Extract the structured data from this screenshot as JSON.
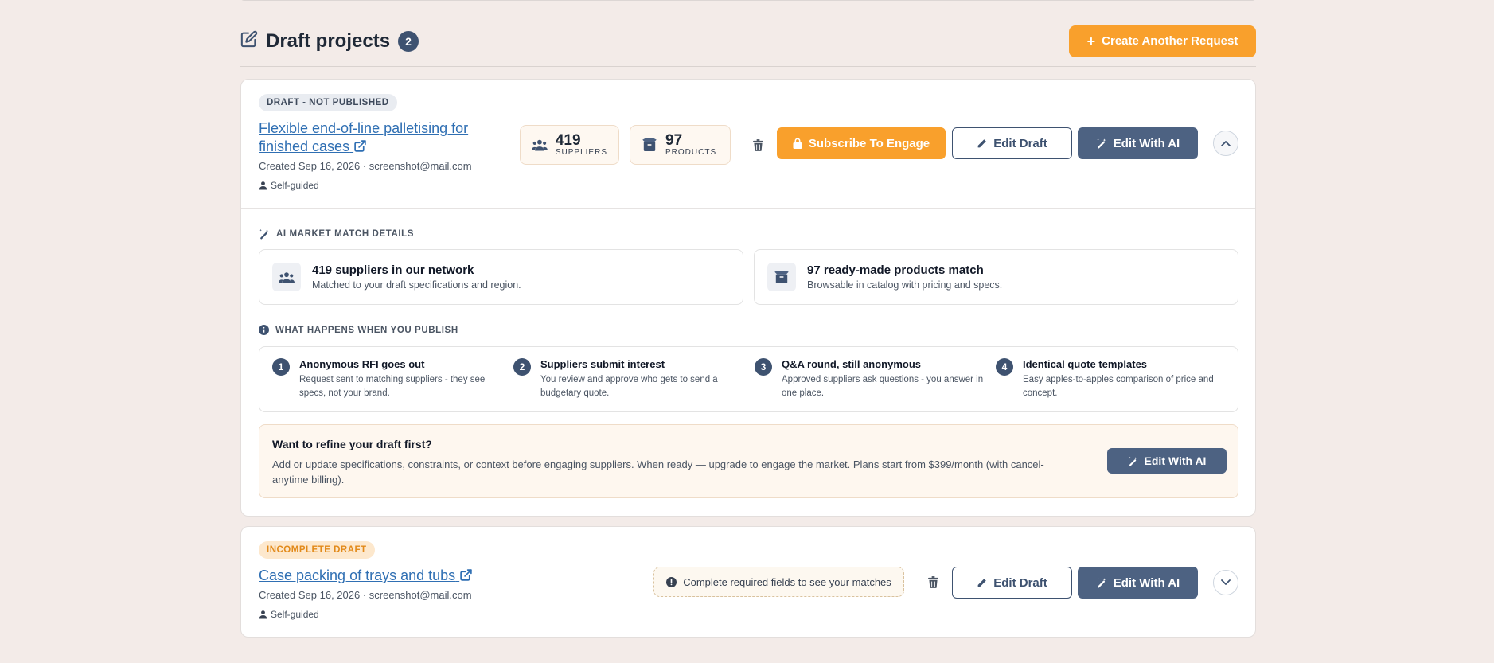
{
  "header": {
    "title": "Draft projects",
    "count": "2",
    "create_label": "Create Another Request"
  },
  "project1": {
    "status": "DRAFT - NOT PUBLISHED",
    "title": "Flexible end-of-line palletising for finished cases",
    "created": "Created Sep 16, 2026 · screenshot@mail.com",
    "mode": "Self-guided",
    "suppliers_count": "419",
    "suppliers_label": "SUPPLIERS",
    "products_count": "97",
    "products_label": "PRODUCTS",
    "subscribe_label": "Subscribe To Engage",
    "edit_draft_label": "Edit Draft",
    "edit_ai_label": "Edit With AI",
    "details": {
      "heading": "AI MARKET MATCH DETAILS",
      "suppliers_title": "419 suppliers in our network",
      "suppliers_sub": "Matched to your draft specifications and region.",
      "products_title": "97 ready-made products match",
      "products_sub": "Browsable in catalog with pricing and specs."
    },
    "publish": {
      "heading": "WHAT HAPPENS WHEN YOU PUBLISH",
      "steps": [
        {
          "num": "1",
          "title": "Anonymous RFI goes out",
          "desc": "Request sent to matching suppliers - they see specs, not your brand."
        },
        {
          "num": "2",
          "title": "Suppliers submit interest",
          "desc": "You review and approve who gets to send a budgetary quote."
        },
        {
          "num": "3",
          "title": "Q&A round, still anonymous",
          "desc": "Approved suppliers ask questions - you answer in one place."
        },
        {
          "num": "4",
          "title": "Identical quote templates",
          "desc": "Easy apples-to-apples comparison of price and concept."
        }
      ]
    },
    "refine": {
      "title": "Want to refine your draft first?",
      "desc": "Add or update specifications, constraints, or context before engaging suppliers. When ready — upgrade to engage the market. Plans start from $399/month (with cancel-anytime billing).",
      "button": "Edit With AI"
    }
  },
  "project2": {
    "status": "INCOMPLETE DRAFT",
    "title": "Case packing of trays and tubs",
    "created": "Created Sep 16, 2026 · screenshot@mail.com",
    "mode": "Self-guided",
    "notice": "Complete required fields to see your matches",
    "edit_draft_label": "Edit Draft",
    "edit_ai_label": "Edit With AI"
  },
  "colors": {
    "accent_orange": "#f9a02c",
    "navy": "#3e5270",
    "link": "#2f6fb3",
    "background": "#f3ebe8"
  }
}
